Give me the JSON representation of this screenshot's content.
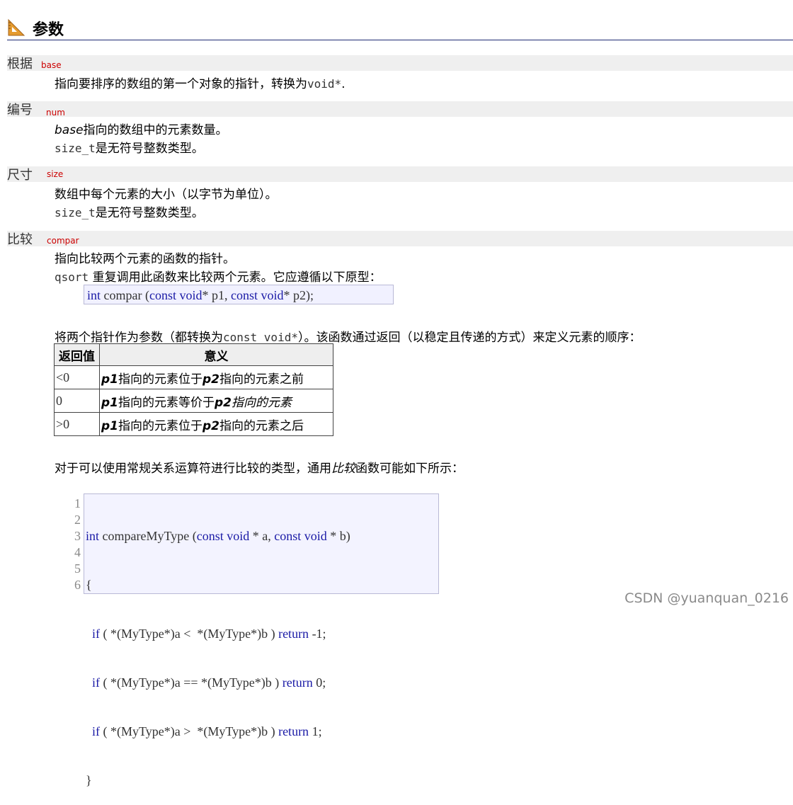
{
  "heading": {
    "title": "参数"
  },
  "params": [
    {
      "cn": "根据",
      "en": "base",
      "lines": [
        {
          "text": "指向要排序的数组的第一个对象的指针，转换为",
          "code": "void*",
          "tail": "."
        }
      ]
    },
    {
      "cn": "编号",
      "en": "num",
      "desc1_ital": "base",
      "desc1_rest": "指向的数组中的元素数量。",
      "desc2_code": "size_t",
      "desc2_rest": "是无符号整数类型。"
    },
    {
      "cn": "尺寸",
      "en": "size",
      "desc1": "数组中每个元素的大小（以字节为单位）。",
      "desc2_code": "size_t",
      "desc2_rest": "是无符号整数类型。"
    },
    {
      "cn": "比较",
      "en": "compar",
      "desc1": "指向比较两个元素的函数的指针。",
      "desc2_code": "qsort",
      "desc2_rest": " 重复调用此函数来比较两个元素。它应遵循以下原型：",
      "proto_kw1": "int",
      "proto_mid": " compar (",
      "proto_kw2": "const void",
      "proto_p1": "* p1, ",
      "proto_kw3": "const void",
      "proto_p2": "* p2);",
      "desc3_a": "将两个指针作为参数（都转换为",
      "desc3_code": "const void*",
      "desc3_b": "）。该函数通过返回（以稳定且传递的方式）来定义元素的顺序："
    }
  ],
  "table": {
    "headers": [
      "返回值",
      "意义"
    ],
    "rows": [
      {
        "value": "<0",
        "p1": "p1",
        "mid": "指向的元素位于",
        "p2": "p2",
        "end": "指向的元素之前"
      },
      {
        "value": "0",
        "p1": "p1",
        "mid": "指向的元素等价于",
        "p2": "p2",
        "end": "指向的元素"
      },
      {
        "value": ">0",
        "p1": "p1",
        "mid": "指向的元素位于",
        "p2": "p2",
        "end": "指向的元素之后"
      }
    ]
  },
  "example_intro": {
    "a": "对于可以使用常规关系运算符进行比较的类型，通用",
    "ital": "比较",
    "b": "函数可能如下所示："
  },
  "code": {
    "line_numbers": [
      "1",
      "2",
      "3",
      "4",
      "5",
      "6"
    ],
    "lines": [
      "int compareMyType (const void * a, const void * b)",
      "{",
      "  if ( *(MyType*)a <  *(MyType*)b ) return -1;",
      "  if ( *(MyType*)a == *(MyType*)b ) return 0;",
      "  if ( *(MyType*)a >  *(MyType*)b ) return 1;",
      "}"
    ]
  },
  "watermark": "CSDN @yuanquan_0216",
  "colors": {
    "param_name": "#cc0000",
    "keyword": "#1a1aa6",
    "heading_rule": "#1f2c73"
  }
}
